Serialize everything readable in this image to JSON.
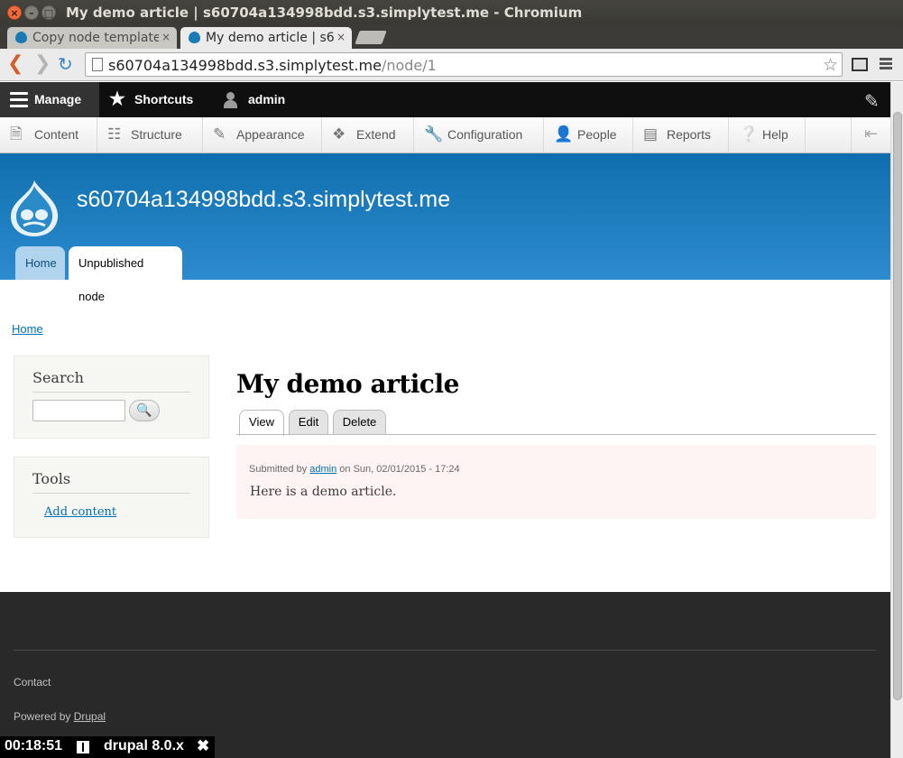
{
  "window": {
    "title": "My demo article | s60704a134998bdd.s3.simplytest.me - Chromium",
    "close_glyph": "×",
    "min_glyph": "–",
    "max_glyph": "□"
  },
  "tabs": [
    {
      "label": "Copy node template",
      "close": "×"
    },
    {
      "label": "My demo article | s60704a134998bdd",
      "close": "×"
    }
  ],
  "browser": {
    "url_host": "s60704a134998bdd.s3.simplytest.me",
    "url_path": "/node/1"
  },
  "admin_bar": {
    "manage": "Manage",
    "shortcuts": "Shortcuts",
    "user": "admin"
  },
  "admin_tray": [
    {
      "label": "Content",
      "icon": "content-icon"
    },
    {
      "label": "Structure",
      "icon": "structure-icon"
    },
    {
      "label": "Appearance",
      "icon": "appearance-icon"
    },
    {
      "label": "Extend",
      "icon": "extend-icon"
    },
    {
      "label": "Configuration",
      "icon": "configuration-icon"
    },
    {
      "label": "People",
      "icon": "people-icon"
    },
    {
      "label": "Reports",
      "icon": "reports-icon"
    },
    {
      "label": "Help",
      "icon": "help-icon"
    }
  ],
  "header": {
    "site_name": "s60704a134998bdd.s3.simplytest.me",
    "tabs": {
      "home": "Home",
      "unpublished": "Unpublished node"
    }
  },
  "breadcrumb": {
    "home": "Home"
  },
  "sidebar": {
    "search": {
      "title": "Search",
      "input_value": ""
    },
    "tools": {
      "title": "Tools",
      "link": "Add content"
    }
  },
  "article": {
    "title": "My demo article",
    "local_tabs": {
      "view": "View",
      "edit": "Edit",
      "delete": "Delete"
    },
    "submitted_prefix": "Submitted by",
    "author": "admin",
    "submitted_suffix": "on Sun, 02/01/2015 - 17:24",
    "body": "Here is a demo article."
  },
  "footer": {
    "contact": "Contact",
    "powered_by": "Powered by",
    "powered_link": "Drupal"
  },
  "simplytest_bar": {
    "timer": "00:18:51",
    "project": "drupal 8.0.x",
    "close": "✖"
  },
  "colors": {
    "header_blue": "#0f6fae",
    "link_blue": "#0071b3",
    "footer_bg": "#292929",
    "node_unpublished_bg": "#fff4f4"
  }
}
